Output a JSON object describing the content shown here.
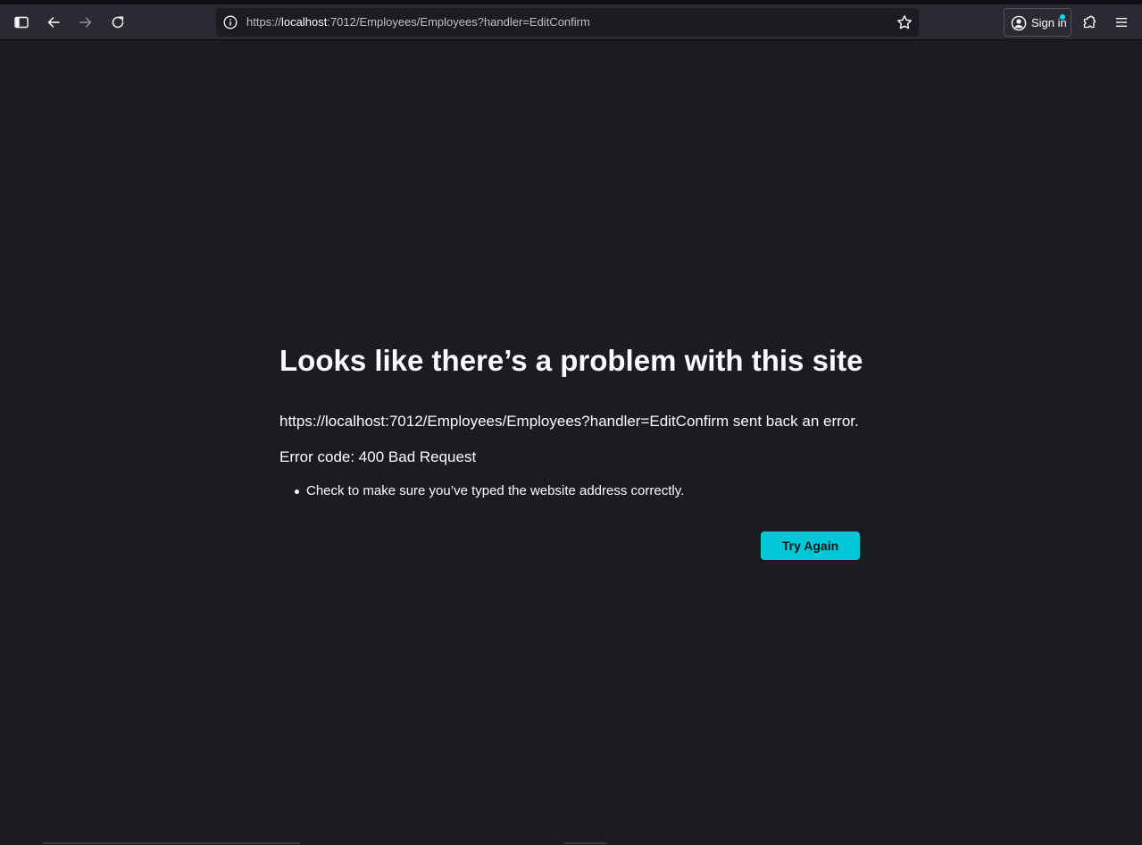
{
  "browser": {
    "url_prefix": "https://",
    "url_host": "localhost",
    "url_rest": ":7012/Employees/Employees?handler=EditConfirm",
    "sign_in_label": "Sign in",
    "icons": [
      "sidebar-icon",
      "back-icon",
      "forward-icon",
      "reload-icon",
      "info-icon",
      "bookmark-star-icon",
      "account-icon",
      "extensions-icon",
      "menu-icon"
    ],
    "accent_color": "#00ddff"
  },
  "error_page": {
    "title": "Looks like there’s a problem with this site",
    "description": "https://localhost:7012/Employees/Employees?handler=EditConfirm sent back an error.",
    "error_code": "Error code: 400 Bad Request",
    "tips": [
      "Check to make sure you’ve typed the website address correctly."
    ],
    "try_again_label": "Try Again",
    "button_color": "#00c8d7"
  }
}
